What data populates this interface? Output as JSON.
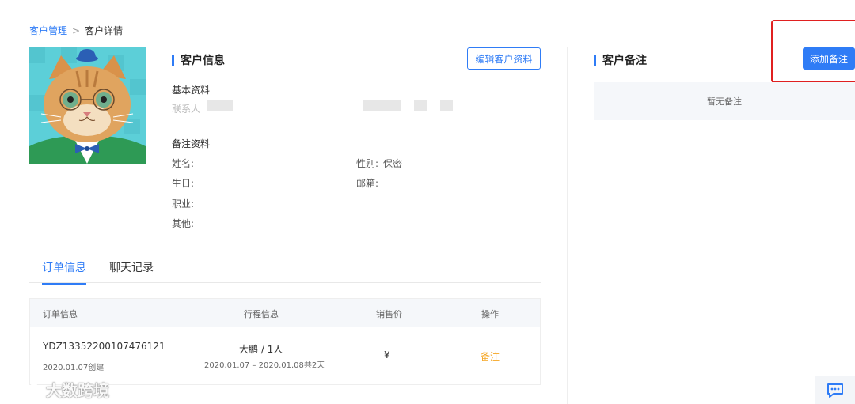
{
  "breadcrumb": {
    "parent": "客户管理",
    "separator": ">",
    "current": "客户详情"
  },
  "customer_info": {
    "title": "客户信息",
    "edit_button": "编辑客户资料",
    "basic_heading": "基本资料",
    "contact_label": "联系人",
    "notes_heading": "备注资料",
    "name_label": "姓名:",
    "gender_label": "性别:",
    "gender_value": "保密",
    "birthday_label": "生日:",
    "email_label": "邮箱:",
    "job_label": "职业:",
    "other_label": "其他:"
  },
  "tabs": [
    {
      "label": "订单信息",
      "active": true
    },
    {
      "label": "聊天记录",
      "active": false
    }
  ],
  "order_table": {
    "headers": [
      "订单信息",
      "行程信息",
      "销售价",
      "操作"
    ],
    "rows": [
      {
        "order_id": "YDZ13352200107476121",
        "created": "2020.01.07创建",
        "trip_name": "大鹏 / 1人",
        "trip_dates": "2020.01.07 – 2020.01.08共2天",
        "price": "¥",
        "action": "备注"
      }
    ]
  },
  "remarks": {
    "title": "客户备注",
    "add_button": "添加备注",
    "empty_text": "暂无备注"
  },
  "watermark": {
    "text": "大数跨境"
  },
  "colors": {
    "accent": "#2f7cf6",
    "action_orange": "#f5a623",
    "highlight_red": "#e02020"
  }
}
